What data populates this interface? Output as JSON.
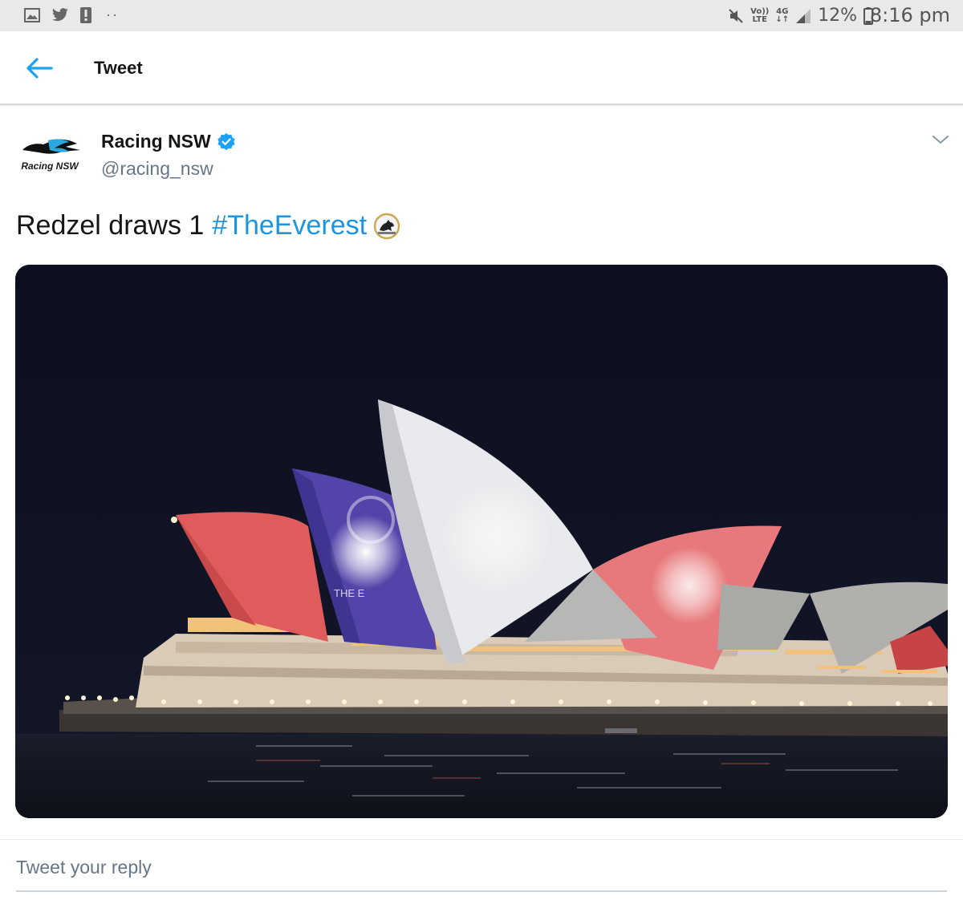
{
  "status_bar": {
    "battery_percent": "12%",
    "time": "8:16 pm",
    "volte_top": "Vo))",
    "volte_bottom": "LTE",
    "network": "4G",
    "left_icons": [
      "image-icon",
      "twitter-bird-icon",
      "alert-icon"
    ],
    "right_icons": [
      "mute-icon",
      "signal-icon",
      "battery-icon"
    ]
  },
  "header": {
    "title": "Tweet"
  },
  "tweet": {
    "author_name": "Racing NSW",
    "author_handle": "@racing_nsw",
    "avatar_text": "Racing NSW",
    "verified": true,
    "text": "Redzel draws 1",
    "hashtag": "#TheEverest",
    "emoji": "the-everest-emoji",
    "media": {
      "description_kind": "photo",
      "projection_text": "THE E"
    }
  },
  "reply": {
    "placeholder": "Tweet your reply"
  },
  "colors": {
    "link": "#1b95e0",
    "back_arrow": "#1da1f2",
    "verified": "#1da1f2",
    "secondary_text": "#657786"
  }
}
